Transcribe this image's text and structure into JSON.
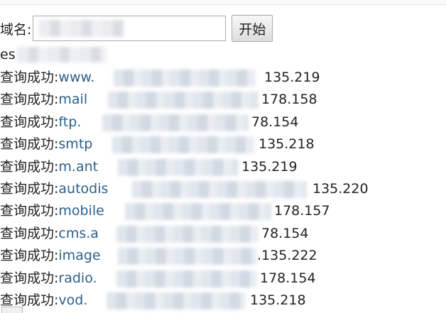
{
  "form": {
    "domain_label": "域名:",
    "domain_value": "",
    "start_button": "开始"
  },
  "status": {
    "text": "es"
  },
  "results": [
    {
      "prefix": "查询成功:",
      "host": "www.",
      "ip_tail": "135.219"
    },
    {
      "prefix": "查询成功:",
      "host": "mail",
      "ip_tail": "178.158"
    },
    {
      "prefix": "查询成功:",
      "host": "ftp.",
      "ip_tail": "78.154"
    },
    {
      "prefix": "查询成功:",
      "host": "smtp",
      "ip_tail": "135.218"
    },
    {
      "prefix": "查询成功:",
      "host": "m.ant",
      "ip_tail": "135.219"
    },
    {
      "prefix": "查询成功:",
      "host": "autodis",
      "ip_tail": "135.220"
    },
    {
      "prefix": "查询成功:",
      "host": "mobile",
      "ip_tail": "178.157"
    },
    {
      "prefix": "查询成功:",
      "host": "cms.a",
      "ip_tail": "78.154"
    },
    {
      "prefix": "查询成功:",
      "host": "image",
      "ip_tail": ".135.222"
    },
    {
      "prefix": "查询成功:",
      "host": "radio.",
      "ip_tail": "178.154"
    },
    {
      "prefix": "查询成功:",
      "host": "vod.",
      "ip_tail": "135.218"
    }
  ]
}
